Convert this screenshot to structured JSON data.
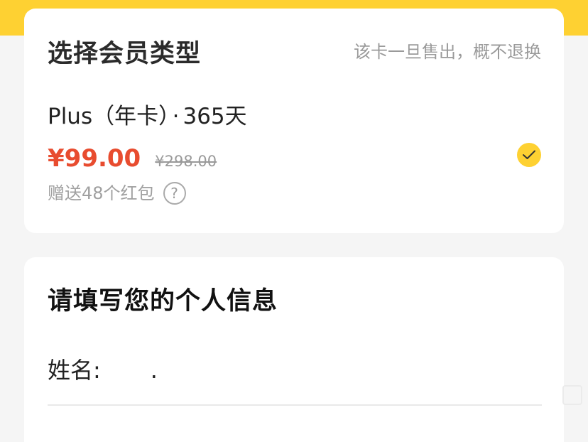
{
  "membership": {
    "title": "选择会员类型",
    "notice": "该卡一旦售出，概不退换",
    "plan": {
      "name": "Plus（年卡）",
      "separator": "·",
      "duration": "365天",
      "price": "¥99.00",
      "original_price": "¥298.00",
      "gift": "赠送48个红包",
      "help_glyph": "?",
      "selected": true
    }
  },
  "info": {
    "title": "请填写您的个人信息",
    "name_label": "姓名:",
    "name_value": "."
  },
  "colors": {
    "accent": "#fed132",
    "price": "#e84c2f",
    "muted": "#9a9a9a",
    "text": "#222222"
  },
  "icons": {
    "check": "check-icon",
    "help": "help-icon"
  }
}
